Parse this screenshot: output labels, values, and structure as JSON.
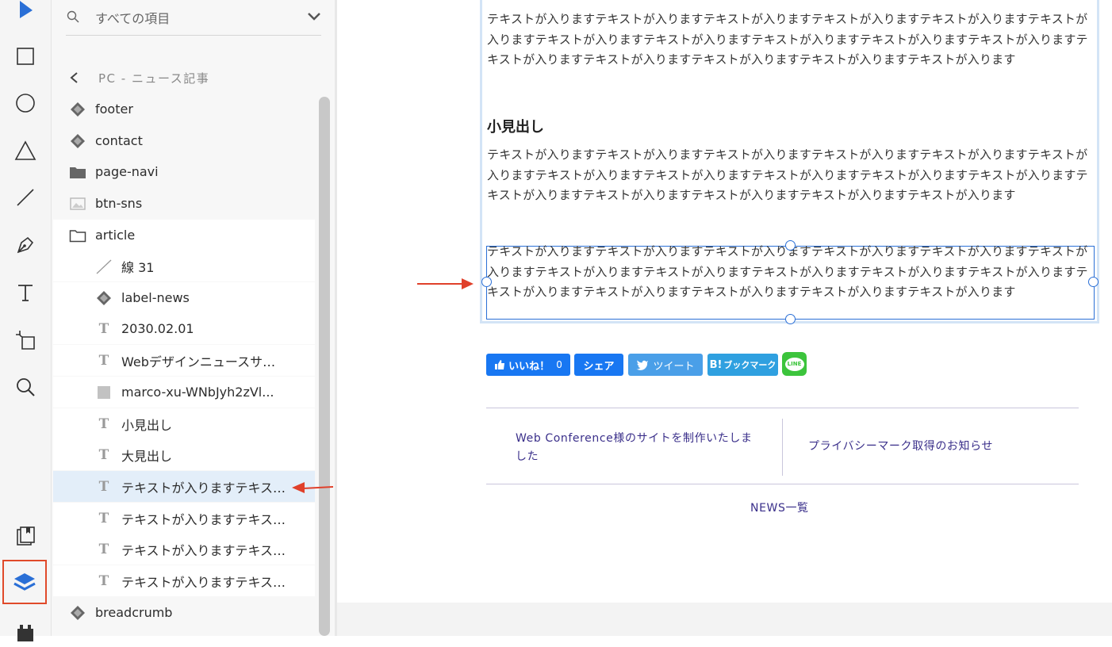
{
  "toolbar": {
    "tools": [
      "select-tool",
      "rectangle-tool",
      "ellipse-tool",
      "triangle-tool",
      "line-tool",
      "pen-tool",
      "text-tool",
      "artboard-tool",
      "zoom-tool"
    ],
    "bottom": [
      "assets-panel",
      "layers-panel",
      "plugins"
    ]
  },
  "layers_panel": {
    "search_placeholder": "すべての項目",
    "breadcrumb": "PC - ニュース記事",
    "items": [
      {
        "label": "footer",
        "icon": "component-icon"
      },
      {
        "label": "contact",
        "icon": "component-icon"
      },
      {
        "label": "page-navi",
        "icon": "folder-icon"
      },
      {
        "label": "btn-sns",
        "icon": "image-icon"
      },
      {
        "label": "article",
        "icon": "folder-open-icon"
      },
      {
        "label": "線 31",
        "icon": "line-icon"
      },
      {
        "label": "label-news",
        "icon": "component-icon"
      },
      {
        "label": "2030.02.01",
        "icon": "text-icon"
      },
      {
        "label": "Webデザインニュースサ…",
        "icon": "text-icon"
      },
      {
        "label": "marco-xu-WNbJyh2zVl...",
        "icon": "rectangle-icon"
      },
      {
        "label": "小見出し",
        "icon": "text-icon"
      },
      {
        "label": "大見出し",
        "icon": "text-icon"
      },
      {
        "label": "テキストが入りますテキス…",
        "icon": "text-icon"
      },
      {
        "label": "テキストが入りますテキス…",
        "icon": "text-icon"
      },
      {
        "label": "テキストが入りますテキス…",
        "icon": "text-icon"
      },
      {
        "label": "テキストが入りますテキス…",
        "icon": "text-icon"
      },
      {
        "label": "breadcrumb",
        "icon": "component-icon"
      }
    ]
  },
  "canvas": {
    "para1": "テキストが入りますテキストが入りますテキストが入りますテキストが入りますテキストが入りますテキストが入りますテキストが入りますテキストが入りますテキストが入りますテキストが入りますテキストが入りますテキストが入りますテキストが入りますテキストが入りますテキストが入りますテキストが入ります",
    "subheading": "小見出し",
    "para2": "テキストが入りますテキストが入りますテキストが入りますテキストが入りますテキストが入りますテキストが入りますテキストが入りますテキストが入りますテキストが入りますテキストが入りますテキストが入りますテキストが入りますテキストが入りますテキストが入りますテキストが入りますテキストが入ります",
    "para3": "テキストが入りますテキストが入りますテキストが入りますテキストが入りますテキストが入りますテキストが入りますテキストが入りますテキストが入りますテキストが入りますテキストが入りますテキストが入りますテキストが入りますテキストが入りますテキストが入りますテキストが入りますテキストが入ります",
    "sns": {
      "like": "いいね！",
      "like_count": "0",
      "share": "シェア",
      "tweet": "ツイート",
      "hatena": "ブックマーク",
      "hatena_prefix": "B!",
      "line": "LINE"
    },
    "prev_link": "Web Conference様のサイトを制作いたしました",
    "next_link": "プライバシーマーク取得のお知らせ",
    "news_list": "NEWS一覧",
    "colors": {
      "accent": "#2a6fd6",
      "link": "#3a2f8a",
      "arrow": "#e0402a",
      "facebook": "#1877f2",
      "twitter": "#4a9fe8",
      "line": "#3cc43c"
    }
  }
}
